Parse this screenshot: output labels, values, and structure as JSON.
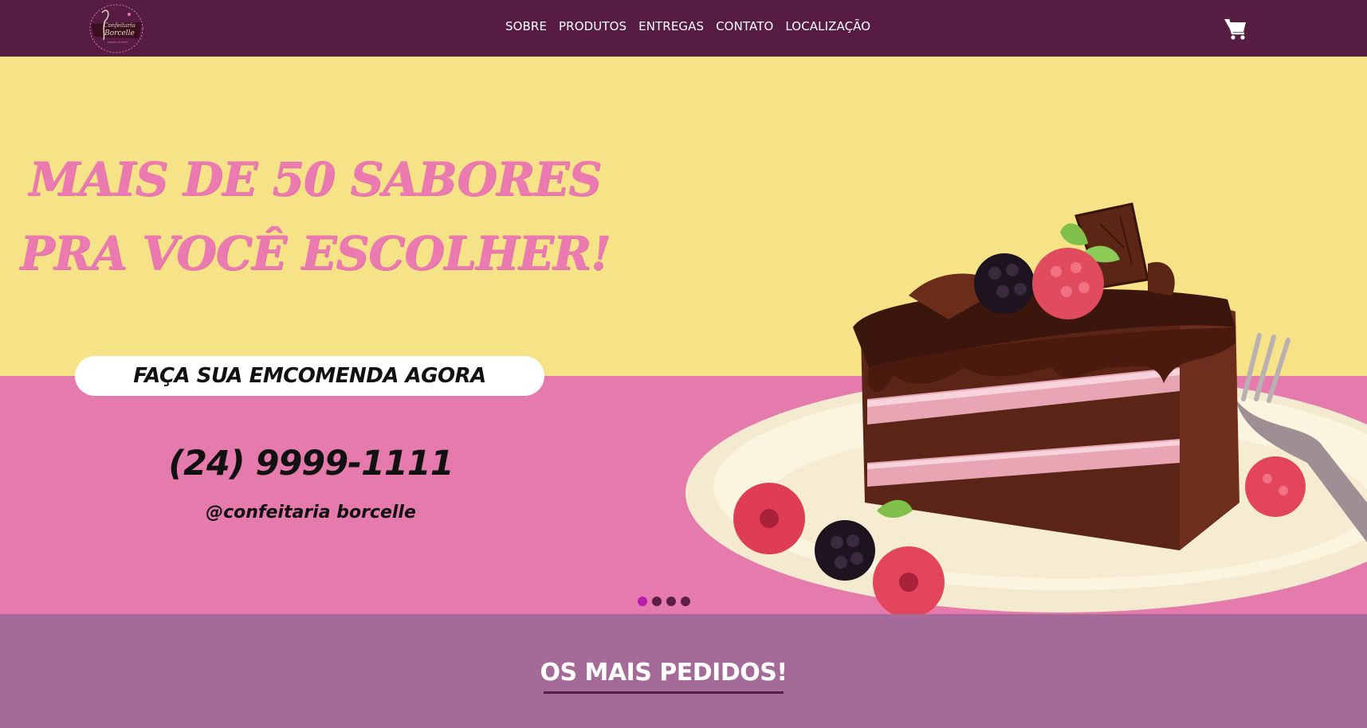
{
  "nav": {
    "logo_icon": "confeitaria-borcelle-logo",
    "menu": [
      {
        "label": "SOBRE"
      },
      {
        "label": "PRODUTOS"
      },
      {
        "label": "ENTREGAS"
      },
      {
        "label": "CONTATO"
      },
      {
        "label": "LOCALIZAÇÃO"
      }
    ],
    "cart_icon": "shopping-cart-icon"
  },
  "hero": {
    "headline_line1": "MAIS DE 50 SABORES",
    "headline_line2": "PRA VOCÊ ESCOLHER!",
    "cta_label": "FAÇA SUA EMCOMENDA AGORA",
    "phone": "(24) 9999-1111",
    "social_handle": "@confeitaria borcelle",
    "carousel": {
      "total": 4,
      "active": 1
    },
    "image": "chocolate-cake-slice-image"
  },
  "section": {
    "title": "OS MAIS PEDIDOS!"
  },
  "colors": {
    "nav_bg": "#561c42",
    "hero_yellow": "#f6e388",
    "hero_pink": "#e57aac",
    "headline_pink": "#ea7aaf",
    "section_bg": "#a56b98",
    "dot_active": "#b81ea8"
  }
}
